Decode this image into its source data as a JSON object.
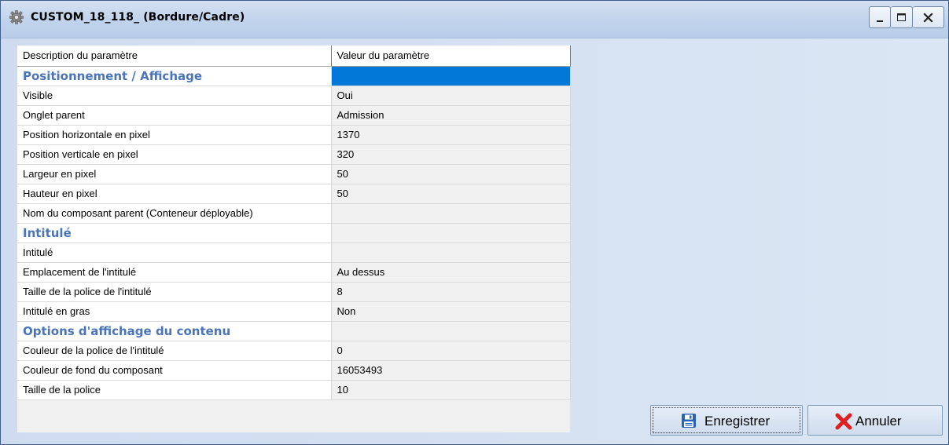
{
  "window": {
    "title": "CUSTOM_18_118_ (Bordure/Cadre)",
    "icons": [
      "gear-icon",
      "minimize-icon",
      "maximize-icon",
      "close-icon"
    ]
  },
  "grid": {
    "headers": [
      "Description du paramètre",
      "Valeur du paramètre"
    ],
    "rows": [
      {
        "type": "section",
        "label": "Positionnement / Affichage",
        "value": ""
      },
      {
        "type": "row",
        "label": "Visible",
        "value": "Oui"
      },
      {
        "type": "row",
        "label": "Onglet parent",
        "value": "Admission"
      },
      {
        "type": "row",
        "label": "Position horizontale en pixel",
        "value": "1370"
      },
      {
        "type": "row",
        "label": "Position verticale en pixel",
        "value": "320"
      },
      {
        "type": "row",
        "label": "Largeur en pixel",
        "value": "50"
      },
      {
        "type": "row",
        "label": "Hauteur en pixel",
        "value": "50"
      },
      {
        "type": "row",
        "label": "Nom du composant parent (Conteneur déployable)",
        "value": ""
      },
      {
        "type": "section",
        "label": "Intitulé",
        "value": ""
      },
      {
        "type": "row",
        "label": "Intitulé",
        "value": ""
      },
      {
        "type": "row",
        "label": "Emplacement de l'intitulé",
        "value": "Au dessus"
      },
      {
        "type": "row",
        "label": "Taille de la police de l'intitulé",
        "value": "8"
      },
      {
        "type": "row",
        "label": "Intitulé en gras",
        "value": "Non"
      },
      {
        "type": "section",
        "label": "Options d'affichage du contenu",
        "value": ""
      },
      {
        "type": "row",
        "label": "Couleur de la police de l'intitulé",
        "value": "0"
      },
      {
        "type": "row",
        "label": "Couleur de fond du composant",
        "value": "16053493"
      },
      {
        "type": "row",
        "label": "Taille de la police",
        "value": "10"
      }
    ]
  },
  "buttons": {
    "save": {
      "label": "Enregistrer",
      "icon": "floppy-disk-icon"
    },
    "cancel": {
      "label": "Annuler",
      "icon": "red-x-icon"
    }
  },
  "colors": {
    "section_text": "#4a74b8",
    "selection": "#0078d7",
    "cancel_icon": "#e02020",
    "save_icon": "#2a62b8"
  }
}
